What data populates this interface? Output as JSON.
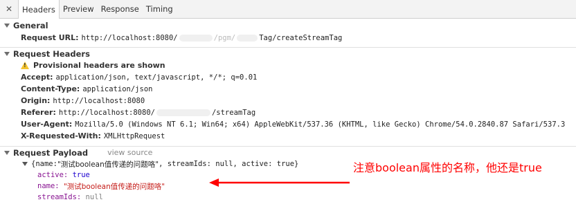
{
  "tabs": {
    "close_glyph": "✕",
    "items": [
      "Headers",
      "Preview",
      "Response",
      "Timing"
    ]
  },
  "general": {
    "title": "General",
    "request_url_key": "Request URL:",
    "request_url_pre": "http://localhost:8080/",
    "request_url_mid": "/pgm/",
    "request_url_post": "Tag/createStreamTag"
  },
  "request_headers": {
    "title": "Request Headers",
    "warning": "Provisional headers are shown",
    "accept_key": "Accept:",
    "accept_val": "application/json, text/javascript, */*; q=0.01",
    "content_type_key": "Content-Type:",
    "content_type_val": "application/json",
    "origin_key": "Origin:",
    "origin_val": "http://localhost:8080",
    "referer_key": "Referer:",
    "referer_pre": "http://localhost:8080/",
    "referer_post": "/streamTag",
    "user_agent_key": "User-Agent:",
    "user_agent_val": "Mozilla/5.0 (Windows NT 6.1; Win64; x64) AppleWebKit/537.36 (KHTML, like Gecko) Chrome/54.0.2840.87 Safari/537.3",
    "xrw_key": "X-Requested-With:",
    "xrw_val": "XMLHttpRequest"
  },
  "payload": {
    "title": "Request Payload",
    "view_source": "view source",
    "summary_open": "{name: ",
    "summary_name": "\"测试boolean值传递的问题咯\"",
    "summary_rest": ", streamIds: null, active: true}",
    "active_key": "active:",
    "active_val": "true",
    "name_key": "name:",
    "name_val": "\"测试boolean值传递的问题咯\"",
    "streamIds_key": "streamIds:",
    "streamIds_val": "null"
  },
  "annotation": {
    "text": "注意boolean属性的名称，他还是true",
    "color": "#ff0000"
  }
}
